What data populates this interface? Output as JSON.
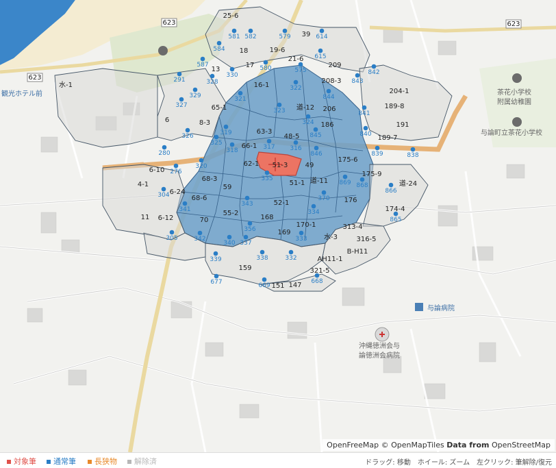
{
  "map": {
    "water_color": "#3b86c9",
    "parcel_fill": "#6ea1c9",
    "target_fill": "#ec7463",
    "road_major": "#e6b277",
    "road_yellow": "#ead9a0",
    "road_badges": [
      "623",
      "623",
      "623"
    ],
    "place_labels": {
      "hotel": "観光ホテル前",
      "school_kindergarten": [
        "茶花小学校",
        "附属幼稚園"
      ],
      "school": "与論町立茶花小学校",
      "hospital_label": "与論病院",
      "clinic": [
        "沖縄徳洲会与",
        "論徳洲会病院"
      ]
    },
    "parcel_labels": [
      "25-6",
      "18",
      "17",
      "39",
      "209",
      "19-6",
      "21-6",
      "13",
      "16-1",
      "208-3",
      "204-1",
      "65-1",
      "6",
      "8-3",
      "道-12",
      "206",
      "189-8",
      "63-3",
      "186",
      "48-5",
      "191",
      "66-1",
      "189-7",
      "62-1",
      "51-3",
      "49",
      "175-6",
      "6-10",
      "68-3",
      "4-1",
      "59",
      "51-1",
      "道-11",
      "175-9",
      "道-24",
      "6-24",
      "68-6",
      "52-1",
      "176",
      "174-4",
      "11",
      "6-12",
      "70",
      "55-2",
      "168",
      "170-1",
      "313-4",
      "169",
      "水-3",
      "316-5",
      "159",
      "AH11-1",
      "B-H11",
      "321-5",
      "147",
      "151",
      "水-1"
    ],
    "point_numbers": [
      "581",
      "582",
      "579",
      "614",
      "584",
      "615",
      "587",
      "330",
      "580",
      "575",
      "842",
      "291",
      "328",
      "843",
      "329",
      "322",
      "321",
      "844",
      "327",
      "323",
      "324",
      "841",
      "845",
      "840",
      "319",
      "326",
      "317",
      "316",
      "846",
      "325",
      "318",
      "839",
      "838",
      "280",
      "320",
      "276",
      "335",
      "869",
      "868",
      "866",
      "304",
      "343",
      "370",
      "341",
      "334",
      "865",
      "305",
      "342",
      "356",
      "337",
      "333",
      "340",
      "339",
      "338",
      "332",
      "677",
      "669",
      "668"
    ]
  },
  "attribution": {
    "prefix": "OpenFreeMap © OpenMapTiles ",
    "bold": "Data from",
    "suffix": " OpenStreetMap"
  },
  "legend": {
    "target": "対象筆",
    "normal": "通常筆",
    "long_narrow": "長狭物",
    "released": "解除済",
    "hint": "ドラッグ: 移動　ホイール: ズーム　左クリック: 筆解除/復元"
  },
  "colors": {
    "target": "#e0524b",
    "normal": "#2a7ec6",
    "long_narrow": "#e88a2b",
    "released": "#b7b7b7"
  }
}
